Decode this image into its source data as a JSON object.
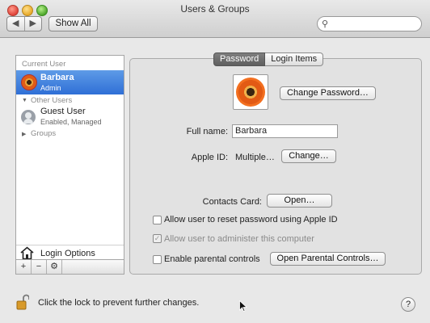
{
  "window": {
    "title": "Users & Groups"
  },
  "toolbar": {
    "back": "◀",
    "forward": "▶",
    "show_all": "Show All",
    "search_placeholder": ""
  },
  "sidebar": {
    "current_header": "Current User",
    "current_user": {
      "name": "Barbara",
      "role": "Admin"
    },
    "other_header": "Other Users",
    "guest": {
      "name": "Guest User",
      "status": "Enabled, Managed"
    },
    "groups_label": "Groups",
    "login_options": "Login Options",
    "buttons": {
      "add": "+",
      "remove": "−",
      "action": "⚙"
    }
  },
  "tabs": {
    "password": "Password",
    "login_items": "Login Items"
  },
  "form": {
    "change_password": "Change Password…",
    "full_name_label": "Full name:",
    "full_name_value": "Barbara",
    "apple_id_label": "Apple ID:",
    "apple_id_value": "Multiple…",
    "change_label": "Change…",
    "contacts_label": "Contacts Card:",
    "open_label": "Open…",
    "allow_reset": "Allow user to reset password using Apple ID",
    "allow_admin": "Allow user to administer this computer",
    "parental": "Enable parental controls",
    "open_parental": "Open Parental Controls…"
  },
  "footer": {
    "lock_text": "Click the lock to prevent further changes.",
    "help": "?"
  }
}
